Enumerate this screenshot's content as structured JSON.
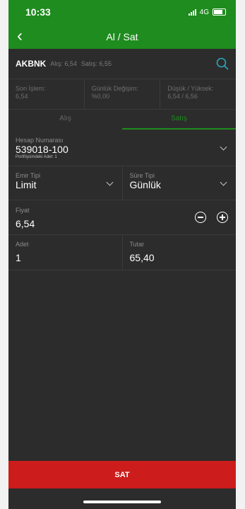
{
  "status_bar": {
    "time": "10:33",
    "network": "4G"
  },
  "nav": {
    "title": "Al / Sat"
  },
  "symbol": {
    "code": "AKBNK",
    "bid": "Alış: 6,54",
    "ask": "Satış: 6,55"
  },
  "stats": [
    {
      "label": "Son İşlem:",
      "value": "6,54"
    },
    {
      "label": "Günlük Değişim:",
      "value": "%0,00"
    },
    {
      "label": "Düşük / Yüksek:",
      "value": "6,54 / 6,56"
    }
  ],
  "tabs": [
    {
      "label": "Alış",
      "active": false
    },
    {
      "label": "Satış",
      "active": true
    }
  ],
  "account": {
    "label": "Hesap Numarası",
    "value": "539018-100",
    "sub": "Portföyümdeki Adet: 1"
  },
  "order": {
    "type_label": "Emir Tipi",
    "type_value": "Limit",
    "duration_label": "Süre Tipi",
    "duration_value": "Günlük"
  },
  "price": {
    "label": "Fiyat",
    "value": "6,54"
  },
  "amounts": {
    "qty_label": "Adet",
    "qty_value": "1",
    "total_label": "Tutar",
    "total_value": "65,40"
  },
  "action": {
    "label": "SAT"
  },
  "colors": {
    "brand_green": "#1e8c1e",
    "sell_red": "#cc1c1c",
    "background": "#2c2c2c"
  },
  "icons": {
    "back": "chevron-left-icon",
    "search": "search-icon",
    "minus": "minus-circle-icon",
    "plus": "plus-circle-icon"
  }
}
